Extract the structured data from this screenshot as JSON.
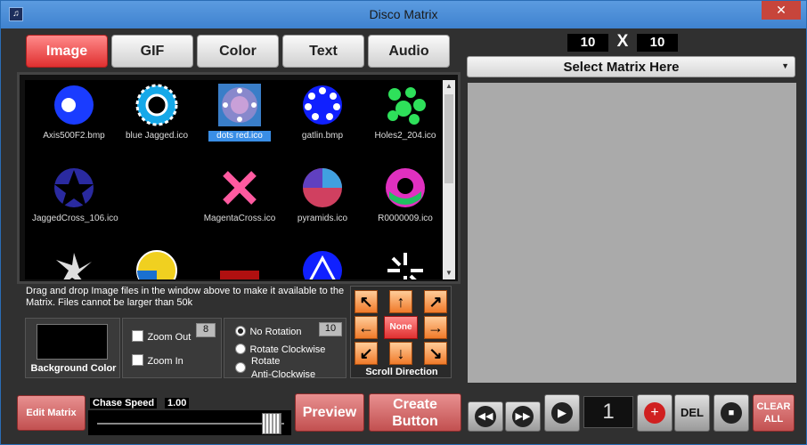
{
  "window": {
    "title": "Disco Matrix",
    "close_glyph": "✕"
  },
  "tabs": [
    "Image",
    "GIF",
    "Color",
    "Text",
    "Audio"
  ],
  "gallery": {
    "items": [
      {
        "name": "Axis500F2.bmp",
        "selected": false
      },
      {
        "name": "blue Jagged.ico",
        "selected": false
      },
      {
        "name": "dots red.ico",
        "selected": true
      },
      {
        "name": "gatlin.bmp",
        "selected": false
      },
      {
        "name": "Holes2_204.ico",
        "selected": false
      },
      {
        "name": "JaggedCross_106.ico",
        "selected": false
      },
      {
        "name": "MagentaCross.ico",
        "selected": false
      },
      {
        "name": "pyramids.ico",
        "selected": false
      },
      {
        "name": "R0000009.ico",
        "selected": false
      }
    ]
  },
  "info_text": "Drag and drop Image files in the window above to make it available to the Matrix. Files cannot be larger than 50k",
  "background_color_label": "Background Color",
  "zoom": {
    "zoom_out_label": "Zoom Out",
    "zoom_in_label": "Zoom In",
    "value": "8"
  },
  "rotation": {
    "no_rotation": "No Rotation",
    "clockwise": "Rotate Clockwise",
    "anti_1": "Rotate",
    "anti_2": "Anti-Clockwise",
    "value": "10"
  },
  "scroll": {
    "none_label": "None",
    "label": "Scroll Direction"
  },
  "bottom": {
    "edit_matrix": "Edit Matrix",
    "chase_speed_label": "Chase Speed",
    "chase_speed_value": "1.00",
    "preview": "Preview",
    "create_button_1": "Create",
    "create_button_2": "Button"
  },
  "matrix": {
    "width": "10",
    "x_label": "X",
    "height": "10",
    "select_label": "Select Matrix Here"
  },
  "transport": {
    "counter": "1",
    "del": "DEL",
    "clear_1": "CLEAR",
    "clear_2": "ALL"
  }
}
